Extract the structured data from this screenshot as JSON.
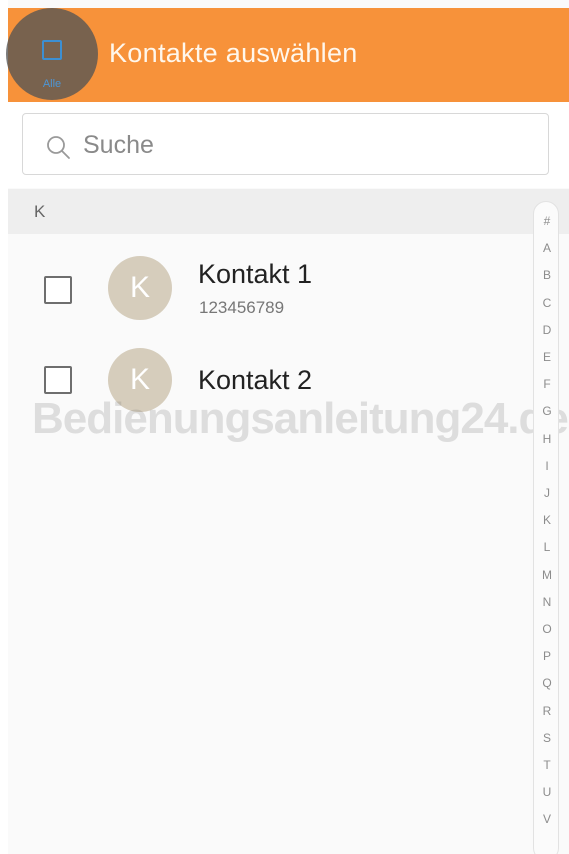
{
  "header": {
    "select_all_label": "Alle",
    "title": "Kontakte auswählen",
    "color": "#f7923a"
  },
  "search": {
    "placeholder": "Suche",
    "icon": "search-icon"
  },
  "section": {
    "letter": "K"
  },
  "contacts": [
    {
      "initial": "K",
      "name": "Kontakt 1",
      "number": "123456789",
      "checked": false
    },
    {
      "initial": "K",
      "name": "Kontakt 2",
      "number": "",
      "checked": false
    }
  ],
  "watermark": "Bedienungsanleitung24.de",
  "index": [
    "#",
    "A",
    "B",
    "C",
    "D",
    "E",
    "F",
    "G",
    "H",
    "I",
    "J",
    "K",
    "L",
    "M",
    "N",
    "O",
    "P",
    "Q",
    "R",
    "S",
    "T",
    "U",
    "V"
  ]
}
